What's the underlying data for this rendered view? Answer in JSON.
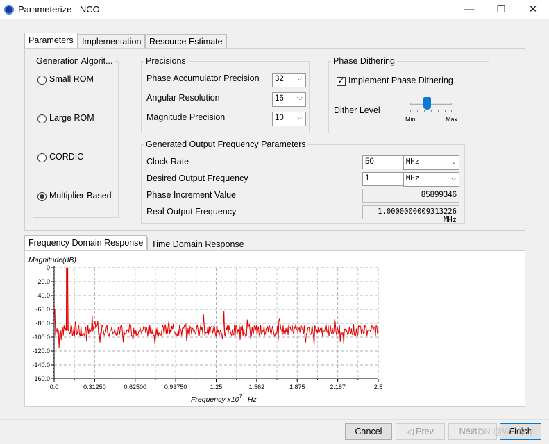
{
  "window": {
    "title": "Parameterize - NCO",
    "minimize": "—",
    "maximize": "☐",
    "close": "✕"
  },
  "top_tabs": [
    "Parameters",
    "Implementation",
    "Resource Estimate"
  ],
  "generation": {
    "title": "Generation Algorit...",
    "options": [
      "Small ROM",
      "Large ROM",
      "CORDIC",
      "Multiplier-Based"
    ],
    "selected": "Multiplier-Based"
  },
  "precisions": {
    "title": "Precisions",
    "rows": [
      {
        "label": "Phase Accumulator Precision",
        "value": "32"
      },
      {
        "label": "Angular Resolution",
        "value": "16"
      },
      {
        "label": "Magnitude Precision",
        "value": "10"
      }
    ]
  },
  "dithering": {
    "title": "Phase Dithering",
    "checkbox_label": "Implement Phase Dithering",
    "checked": true,
    "level_label": "Dither Level",
    "min_label": "Min",
    "max_label": "Max",
    "level": 0.4
  },
  "output": {
    "title": "Generated Output Frequency Parameters",
    "clock_label": "Clock Rate",
    "clock_value": "50",
    "clock_unit": "MHz",
    "desired_label": "Desired Output Frequency",
    "desired_value": "1",
    "desired_unit": "MHz",
    "phase_inc_label": "Phase Increment Value",
    "phase_inc_value": "85899346",
    "real_label": "Real Output Frequency",
    "real_value": "1.0000000009313226 MHz"
  },
  "bottom_tabs": [
    "Frequency Domain Response",
    "Time Domain Response"
  ],
  "chart_data": {
    "type": "line",
    "ylabel": "Magnitude(dB)",
    "xlabel": "Frequency x10",
    "xlabel_exp": "7",
    "xlabel_unit": "Hz",
    "ylim": [
      -160,
      0
    ],
    "xlim": [
      0,
      2.5
    ],
    "yticks": [
      0,
      -20,
      -40,
      -60,
      -80,
      -100,
      -120,
      -140,
      -160
    ],
    "ytick_labels": [
      "0",
      "-20.0",
      "-40.0",
      "-60.0",
      "-80.0",
      "-100.0",
      "-120.0",
      "-140.0",
      "-160.0"
    ],
    "xticks": [
      0,
      0.3125,
      0.625,
      0.9375,
      1.25,
      1.5625,
      1.875,
      2.1875,
      2.5
    ],
    "xtick_labels": [
      "0.0",
      "0.31250",
      "0.62500",
      "0.93750",
      "1.25",
      "1.562",
      "1.875",
      "2.187",
      "2.5"
    ],
    "grid": true,
    "color": "#e00000",
    "series": [
      {
        "x": [
          0,
          0.1,
          0.1,
          0.12,
          0.25,
          0.5,
          0.75,
          1.0,
          1.25,
          1.5,
          1.75,
          2.0,
          2.25,
          2.5
        ],
        "values": [
          -90,
          -90,
          0,
          -90,
          -90,
          -90,
          -90,
          -90,
          -90,
          -90,
          -90,
          -90,
          -90,
          -95
        ]
      }
    ],
    "noise_floor": -90,
    "peak_x": 0.1,
    "peak_y": 0
  },
  "buttons": {
    "cancel": "Cancel",
    "prev": "◁ Prev",
    "next": "Next ▷",
    "finish": "Finish"
  },
  "watermark": "CSDN @Wudy_p"
}
